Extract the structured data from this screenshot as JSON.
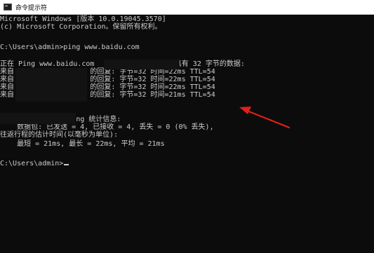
{
  "window": {
    "title": "命令提示符",
    "icon": "console-icon"
  },
  "console": {
    "lines": [
      "Microsoft Windows [版本 10.0.19045.3570]",
      "(c) Microsoft Corporation。保留所有权利。",
      "",
      "C:\\Users\\admin>ping www.baidu.com",
      "",
      "正在 Ping www.baidu.com                   具有 32 字节的数据:",
      "来自                  的回复: 字节=32 时间=22ms TTL=54",
      "来自                  的回复: 字节=32 时间=22ms TTL=54",
      "来自                  的回复: 字节=32 时间=22ms TTL=54",
      "来自                  的回复: 字节=32 时间=21ms TTL=54",
      "",
      "                Ping 统计信息:",
      "    数据包: 已发送 = 4, 已接收 = 4, 丢失 = 0 (0% 丢失),",
      "往返行程的估计时间(以毫秒为单位):",
      "    最短 = 21ms, 最长 = 22ms, 平均 = 21ms",
      "",
      "C:\\Users\\admin>"
    ]
  },
  "annotation": {
    "color": "#e0201a"
  },
  "colors": {
    "background": "#0c0c0c",
    "text": "#cccccc",
    "titlebar": "#ffffff"
  }
}
